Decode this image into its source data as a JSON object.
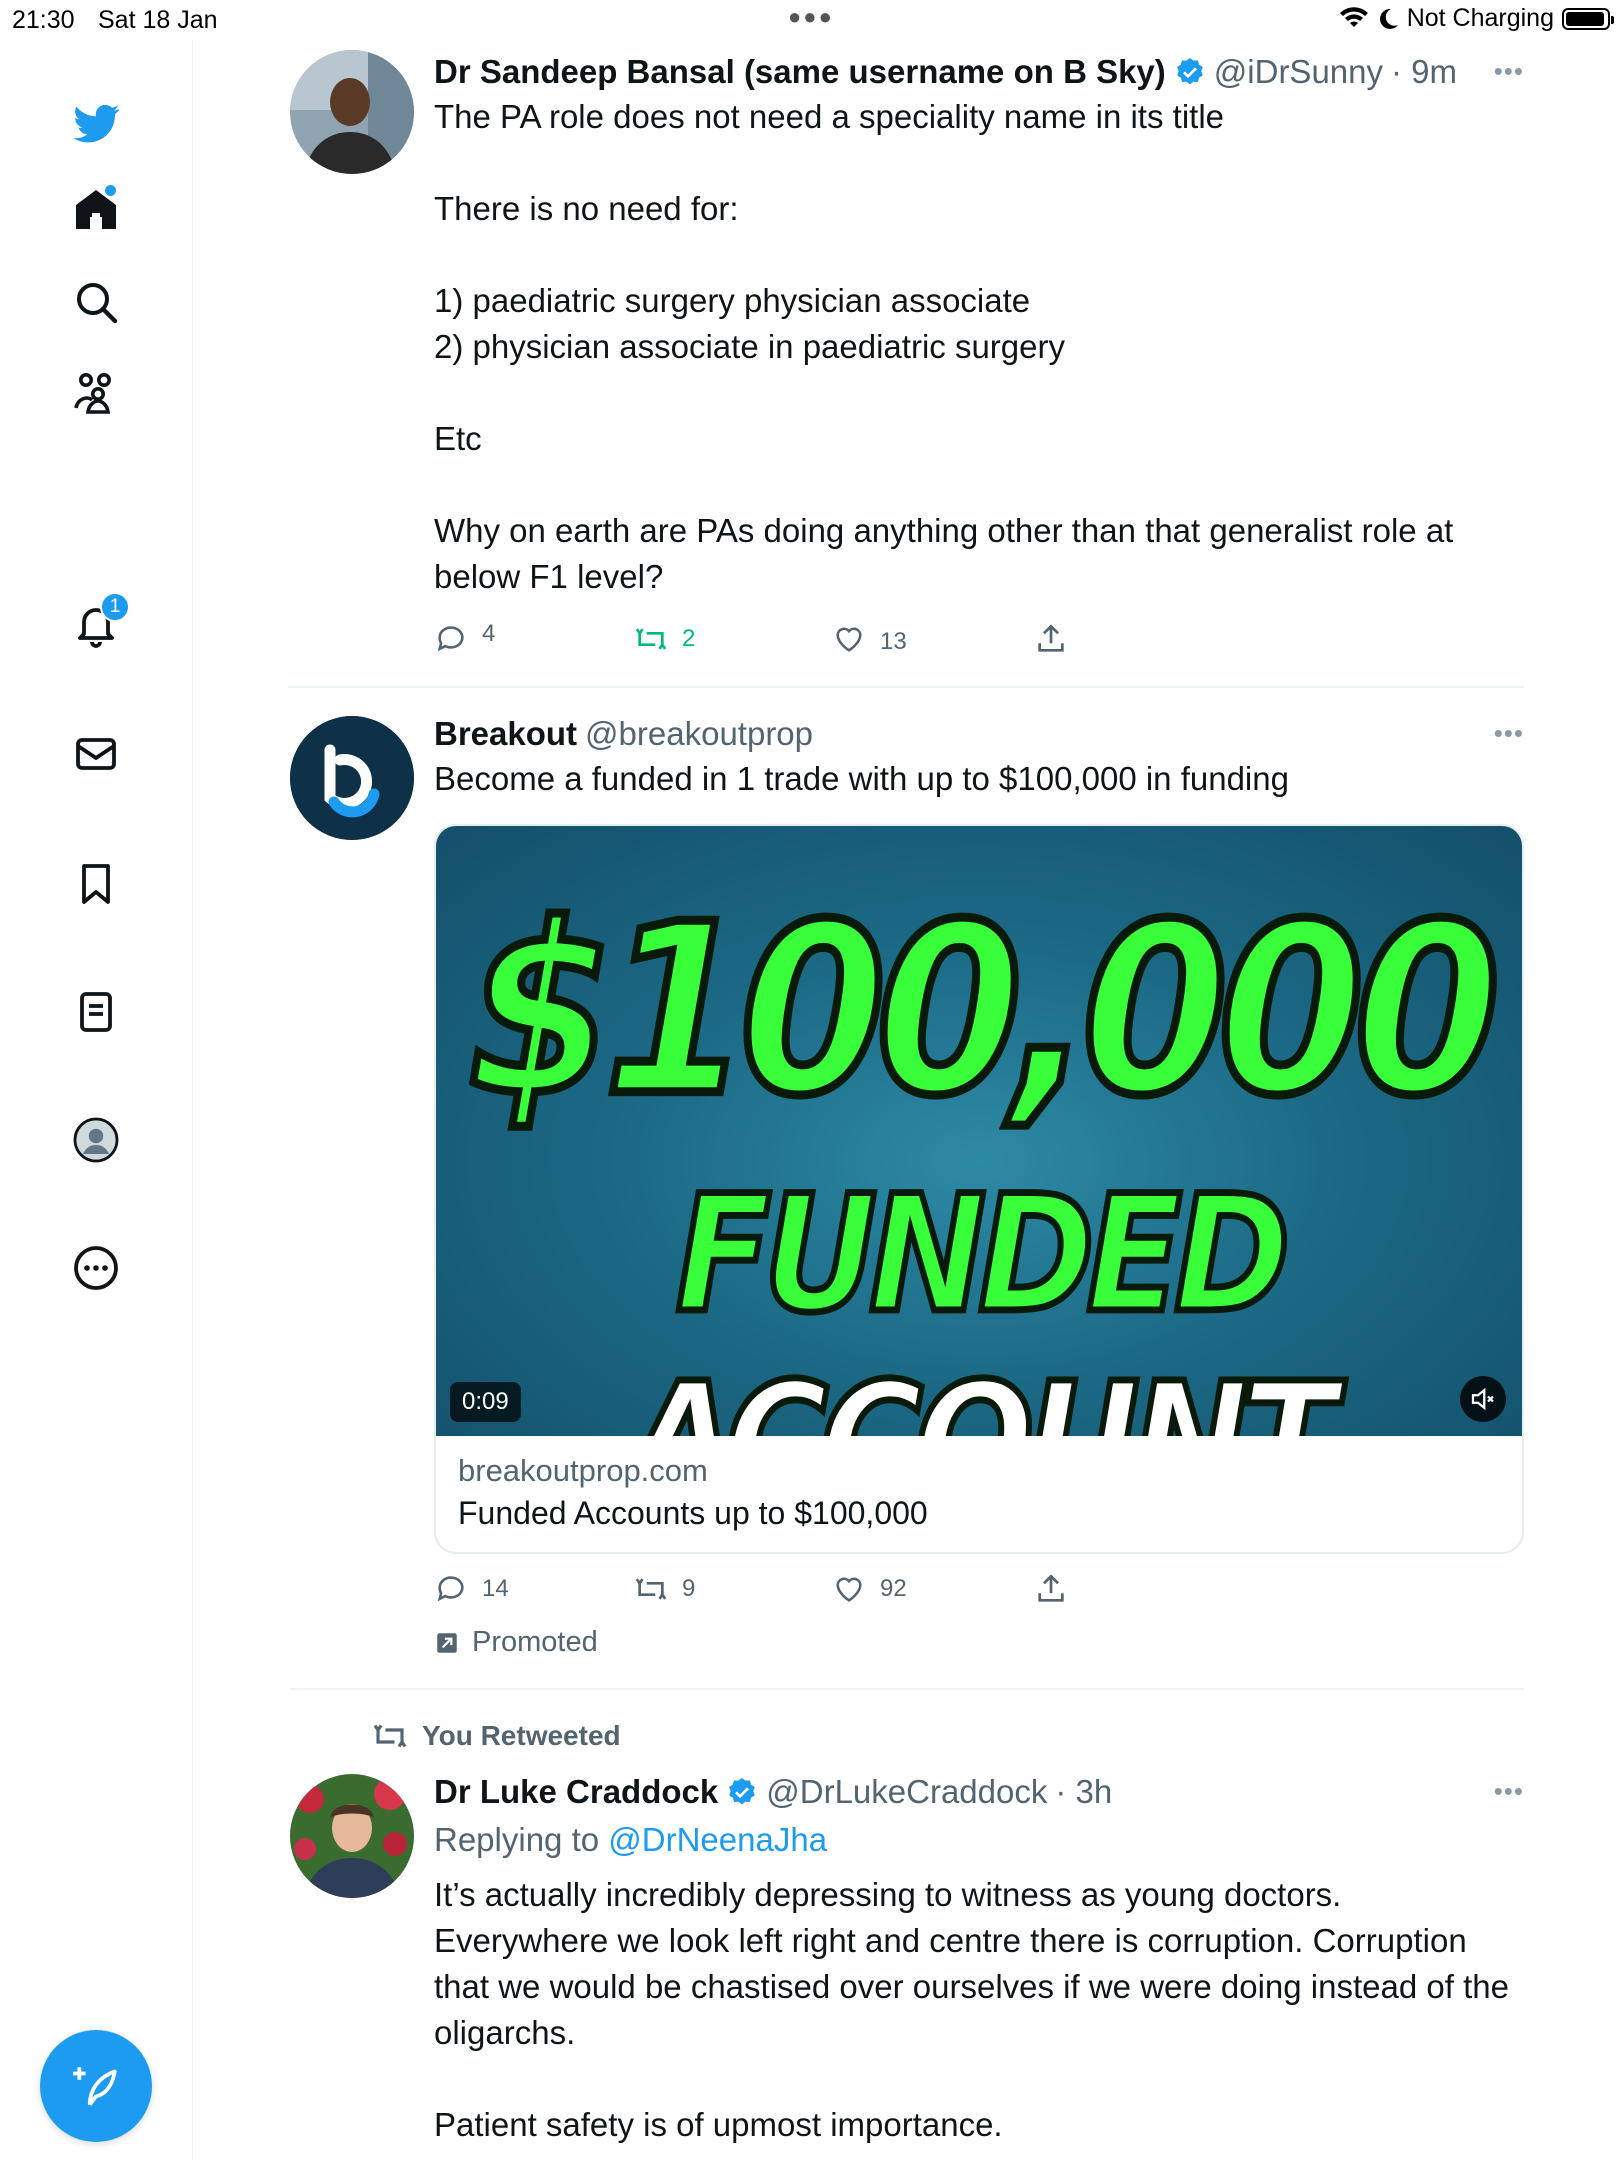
{
  "status_bar": {
    "time": "21:30",
    "date": "Sat 18 Jan",
    "charging": "Not Charging",
    "battery_level": 0.95
  },
  "sidebar": {
    "items": [
      {
        "name": "twitter-logo-icon"
      },
      {
        "name": "home-icon"
      },
      {
        "name": "search-icon"
      },
      {
        "name": "communities-icon"
      },
      {
        "name": "notifications-icon",
        "badge": "1"
      },
      {
        "name": "messages-icon"
      },
      {
        "name": "bookmarks-icon"
      },
      {
        "name": "lists-icon"
      },
      {
        "name": "profile-icon"
      },
      {
        "name": "more-icon"
      }
    ],
    "compose_icon": "compose-icon"
  },
  "colors": {
    "accent": "#1d9bf0",
    "retweet_active": "#00ba7c",
    "muted": "#536471",
    "promo_green": "#39ff3a"
  },
  "tweets": [
    {
      "name": "Dr Sandeep Bansal (same username on B Sky)",
      "handle": "@iDrSunny",
      "time": "· 9m",
      "verified": true,
      "text": "The PA role does not need a speciality name in its title\n\nThere is no need for:\n\n1) paediatric surgery physician associate\n2) physician associate in paediatric surgery\n\nEtc\n\nWhy on earth are PAs doing anything other than that generalist role at below F1 level?",
      "replies": "4",
      "retweets": "2",
      "likes": "13"
    },
    {
      "name": "Breakout",
      "handle": "@breakoutprop",
      "text": "Become a funded in 1 trade with up to $100,000 in funding",
      "media": {
        "headline": "$100,000",
        "line2_green": "FUNDED",
        "line2_white": "ACCOUNT",
        "duration": "0:09"
      },
      "card": {
        "domain": "breakoutprop.com",
        "title": "Funded Accounts up to $100,000"
      },
      "replies": "14",
      "retweets": "9",
      "likes": "92",
      "promoted_label": "Promoted"
    },
    {
      "retweet_label": "You Retweeted",
      "name": "Dr Luke Craddock",
      "handle": "@DrLukeCraddock",
      "time": "· 3h",
      "verified": true,
      "replying_prefix": "Replying to",
      "replying_to": "@DrNeenaJha",
      "text": "It’s actually incredibly depressing to witness as young doctors. Everywhere we look left right and centre there is corruption. Corruption that we would be chastised over ourselves if we were doing instead of the oligarchs.\n\nPatient safety is of upmost importance."
    }
  ]
}
